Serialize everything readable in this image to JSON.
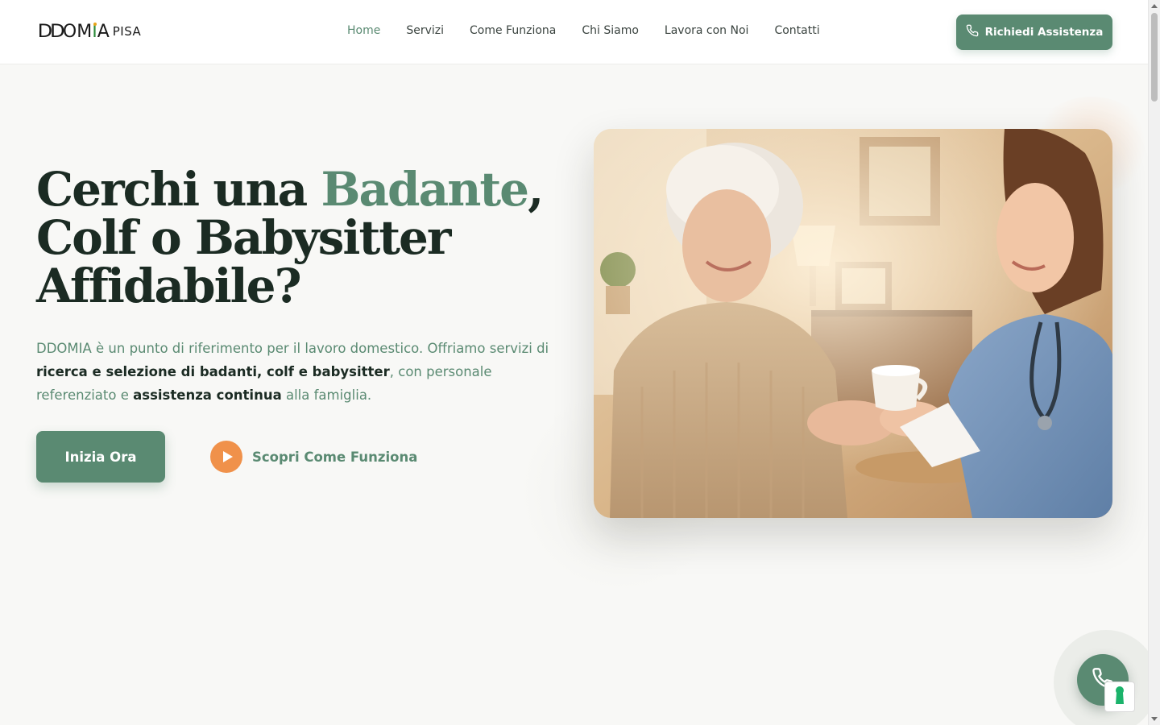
{
  "brand": {
    "logo_letters": "DDOMIA",
    "logo_suffix": "PISA"
  },
  "nav": {
    "items": [
      {
        "label": "Home",
        "active": true
      },
      {
        "label": "Servizi",
        "active": false
      },
      {
        "label": "Come Funziona",
        "active": false
      },
      {
        "label": "Chi Siamo",
        "active": false
      },
      {
        "label": "Lavora con Noi",
        "active": false
      },
      {
        "label": "Contatti",
        "active": false
      }
    ],
    "cta_label": "Richiedi Assistenza",
    "cta_icon": "phone-icon"
  },
  "hero": {
    "title_part1": "Cerchi una ",
    "title_accent": "Badante",
    "title_part2": ",",
    "title_line2": "Colf o Babysitter",
    "title_line3": "Affidabile?",
    "desc": {
      "t1": "DDOMIA è un punto di riferimento per il lavoro domestico. Offriamo servizi di ",
      "b1": "ricerca e selezione di badanti, colf e babysitter",
      "t2": ", con personale referenziato e ",
      "b2": "assistenza continua",
      "t3": " alla famiglia."
    },
    "primary_button": "Inizia Ora",
    "secondary_button": "Scopri Come Funziona",
    "secondary_icon": "play-icon",
    "image_subject": "elderly-woman-with-caregiver-photo"
  },
  "floating": {
    "call_icon": "phone-icon",
    "widget_icon": "keyhole-icon"
  },
  "colors": {
    "accent": "#5a8a72",
    "dark_text": "#1b2b23",
    "play_orange": "#f0914a",
    "background": "#f8f8f6"
  }
}
